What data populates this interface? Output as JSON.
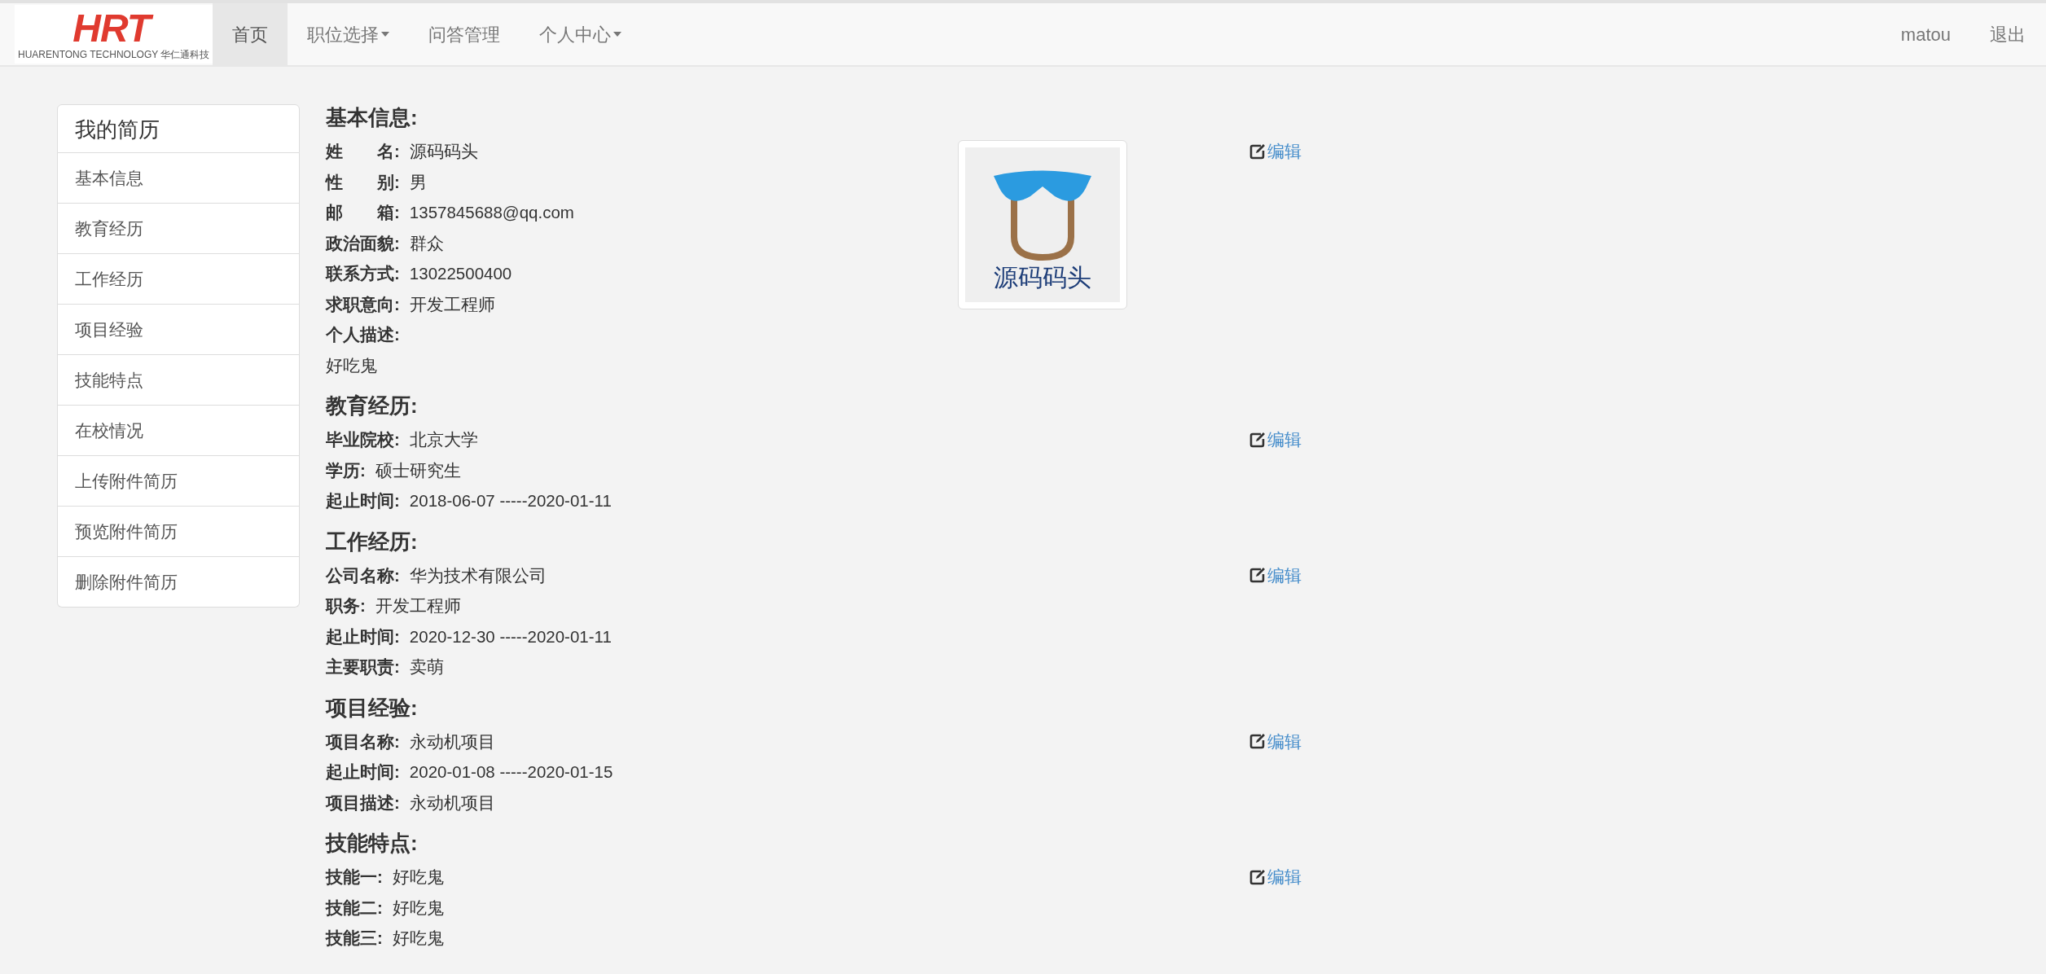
{
  "navbar": {
    "logo": {
      "mark": "HRT",
      "tagline": "HUARENTONG TECHNOLOGY 华仁通科技"
    },
    "items": [
      {
        "label": "首页",
        "selected": true,
        "dropdown": false
      },
      {
        "label": "职位选择",
        "selected": false,
        "dropdown": true
      },
      {
        "label": "问答管理",
        "selected": false,
        "dropdown": false
      },
      {
        "label": "个人中心",
        "selected": false,
        "dropdown": true
      }
    ],
    "user": "matou",
    "logout": "退出"
  },
  "sidebar": {
    "title": "我的简历",
    "items": [
      {
        "label": "基本信息"
      },
      {
        "label": "教育经历"
      },
      {
        "label": "工作经历"
      },
      {
        "label": "项目经验"
      },
      {
        "label": "技能特点"
      },
      {
        "label": "在校情况"
      },
      {
        "label": "上传附件简历"
      },
      {
        "label": "预览附件简历"
      },
      {
        "label": "删除附件简历"
      }
    ]
  },
  "sections": [
    {
      "title": "基本信息:",
      "edit": "编辑",
      "photo": {
        "caption": "源码码头"
      },
      "fields": [
        {
          "label": "姓　　名:",
          "value": "源码码头",
          "kind": "inline"
        },
        {
          "label": "性　　别:",
          "value": "男",
          "kind": "inline"
        },
        {
          "label": "邮　　箱:",
          "value": "1357845688@qq.com",
          "kind": "inline"
        },
        {
          "label": "政治面貌:",
          "value": "群众",
          "kind": "inline"
        },
        {
          "label": "联系方式:",
          "value": "13022500400",
          "kind": "inline"
        },
        {
          "label": "求职意向:",
          "value": "开发工程师",
          "kind": "inline"
        },
        {
          "label": "个人描述:",
          "value": "好吃鬼",
          "kind": "block"
        }
      ]
    },
    {
      "title": "教育经历:",
      "edit": "编辑",
      "fields": [
        {
          "label": "毕业院校:",
          "value": "北京大学",
          "kind": "inline"
        },
        {
          "label": "学历:",
          "value": "硕士研究生",
          "kind": "inline"
        },
        {
          "label": "起止时间:",
          "value": "2018-06-07 -----2020-01-11",
          "kind": "inline"
        }
      ]
    },
    {
      "title": "工作经历:",
      "edit": "编辑",
      "fields": [
        {
          "label": "公司名称:",
          "value": "华为技术有限公司",
          "kind": "inline"
        },
        {
          "label": "职务:",
          "value": "开发工程师",
          "kind": "inline"
        },
        {
          "label": "起止时间:",
          "value": "2020-12-30 -----2020-01-11",
          "kind": "inline"
        },
        {
          "label": "主要职责:",
          "value": "卖萌",
          "kind": "inline"
        }
      ]
    },
    {
      "title": "项目经验:",
      "edit": "编辑",
      "fields": [
        {
          "label": "项目名称:",
          "value": "永动机项目",
          "kind": "inline"
        },
        {
          "label": "起止时间:",
          "value": "2020-01-08 -----2020-01-15",
          "kind": "inline"
        },
        {
          "label": "项目描述:",
          "value": "永动机项目",
          "kind": "inline"
        }
      ]
    },
    {
      "title": "技能特点:",
      "edit": "编辑",
      "fields": [
        {
          "label": "技能一:",
          "value": "好吃鬼",
          "kind": "inline"
        },
        {
          "label": "技能二:",
          "value": "好吃鬼",
          "kind": "inline"
        },
        {
          "label": "技能三:",
          "value": "好吃鬼",
          "kind": "inline"
        }
      ]
    }
  ]
}
